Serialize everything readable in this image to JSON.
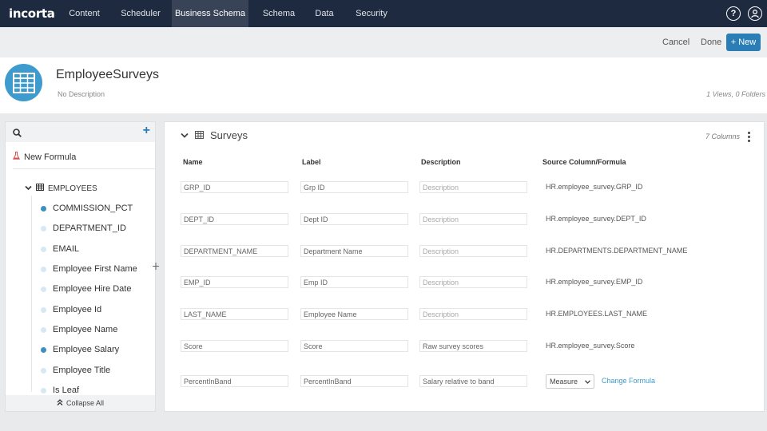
{
  "nav": {
    "logo": "incorta",
    "tabs": [
      "Content",
      "Scheduler",
      "Business Schema",
      "Schema",
      "Data",
      "Security"
    ],
    "active": "Business Schema"
  },
  "actions": {
    "cancel": "Cancel",
    "done": "Done",
    "new": "+ New"
  },
  "schema": {
    "title": "EmployeeSurveys",
    "description": "No Description",
    "meta": "1 Views, 0 Folders"
  },
  "left": {
    "new_formula": "New Formula",
    "group": "EMPLOYEES",
    "columns": [
      {
        "label": "COMMISSION_PCT",
        "filled": true
      },
      {
        "label": "DEPARTMENT_ID",
        "filled": false
      },
      {
        "label": "EMAIL",
        "filled": false
      },
      {
        "label": "Employee First Name",
        "filled": false
      },
      {
        "label": "Employee Hire Date",
        "filled": false
      },
      {
        "label": "Employee Id",
        "filled": false
      },
      {
        "label": "Employee Name",
        "filled": false
      },
      {
        "label": "Employee Salary",
        "filled": true
      },
      {
        "label": "Employee Title",
        "filled": false
      },
      {
        "label": "Is Leaf",
        "filled": false
      }
    ],
    "collapse_all": "Collapse All"
  },
  "table": {
    "name": "Surveys",
    "column_count": "7 Columns",
    "headers": [
      "Name",
      "Label",
      "Description",
      "Source Column/Formula"
    ],
    "rows": [
      {
        "name": "GRP_ID",
        "label": "Grp ID",
        "description": "Description",
        "source": "HR.employee_survey.GRP_ID"
      },
      {
        "name": "DEPT_ID",
        "label": "Dept ID",
        "description": "Description",
        "source": "HR.employee_survey.DEPT_ID"
      },
      {
        "name": "DEPARTMENT_NAME",
        "label": "Department Name",
        "description": "Description",
        "source": "HR.DEPARTMENTS.DEPARTMENT_NAME"
      },
      {
        "name": "EMP_ID",
        "label": "Emp ID",
        "description": "Description",
        "source": "HR.employee_survey.EMP_ID"
      },
      {
        "name": "LAST_NAME",
        "label": "Employee Name",
        "description": "Description",
        "source": "HR.EMPLOYEES.LAST_NAME"
      },
      {
        "name": "Score",
        "label": "Score",
        "description": "Raw survey scores",
        "source": "HR.employee_survey.Score"
      },
      {
        "name": "PercentInBand",
        "label": "PercentInBand",
        "description": "Salary relative to band",
        "type_select": "Measure",
        "change_link": "Change Formula"
      }
    ]
  },
  "colors": {
    "nav_bg": "#1e2a3f",
    "accent": "#2a7db5",
    "icon_blue": "#3d9ccd",
    "formula_red": "#d9534f"
  }
}
